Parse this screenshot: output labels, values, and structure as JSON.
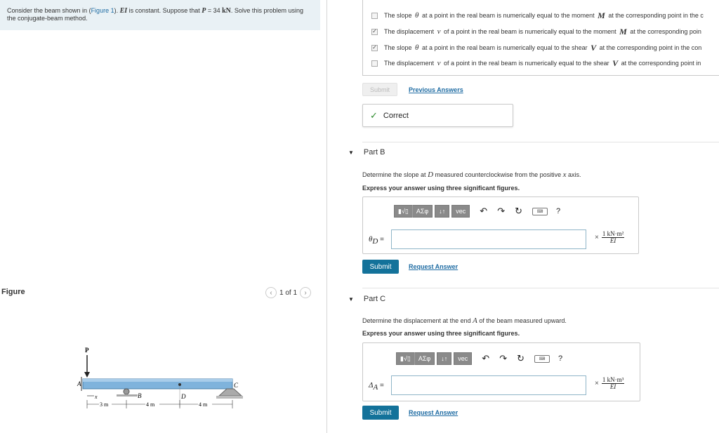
{
  "problem": {
    "text_1": "Consider the beam shown in (",
    "figure_link": "Figure 1",
    "text_2": "). ",
    "ei": "EI",
    "text_3": " is constant. Suppose that ",
    "p_sym": "P",
    "text_4": " = 34 ",
    "unit": "kN",
    "text_5": ". Solve this problem using the conjugate-beam method."
  },
  "figure": {
    "label": "Figure",
    "pager": "1 of 1",
    "labels": {
      "P": "P",
      "A": "A",
      "B": "B",
      "C": "C",
      "D": "D",
      "x": "x",
      "d1": "3 m",
      "d2": "4 m",
      "d3": "4 m"
    }
  },
  "options": [
    {
      "checked": false,
      "pre": "The slope",
      "sym": "θ",
      "mid": "at a point in the real beam is numerically equal to the moment",
      "sym2": "M",
      "post": "at the corresponding point in the c"
    },
    {
      "checked": true,
      "pre": "The displacement",
      "sym": "v",
      "mid": "of a point in the real beam is numerically equal to the moment",
      "sym2": "M",
      "post": "at the corresponding poin"
    },
    {
      "checked": true,
      "pre": "The slope",
      "sym": "θ",
      "mid": "at a point in the real beam is numerically equal to the shear",
      "sym2": "V",
      "post": "at the corresponding point in the con"
    },
    {
      "checked": false,
      "pre": "The displacement",
      "sym": "v",
      "mid": "of a point in the real beam is numerically equal to the shear",
      "sym2": "V",
      "post": "at the corresponding point in"
    }
  ],
  "part_a": {
    "submit": "Submit",
    "previous": "Previous Answers",
    "feedback": "Correct"
  },
  "part_b": {
    "title": "Part B",
    "q1": "Determine the slope at",
    "q_sym": "D",
    "q2": "measured counterclockwise from the positive",
    "q_axis": "x",
    "q3": "axis.",
    "instruction": "Express your answer using three significant figures.",
    "label_sym": "θ",
    "label_sub": "D",
    "label_eq": " =",
    "unit_num": "1 kN·m²",
    "unit_den": "EI",
    "submit": "Submit",
    "request": "Request Answer"
  },
  "part_c": {
    "title": "Part C",
    "q1": "Determine the displacement at the end",
    "q_sym": "A",
    "q2": "of the beam measured upward.",
    "instruction": "Express your answer using three significant figures.",
    "label_sym": "Δ",
    "label_sub": "A",
    "label_eq": " =",
    "unit_num": "1 kN·m³",
    "unit_den": "EI",
    "submit": "Submit",
    "request": "Request Answer"
  },
  "toolbar": {
    "templates": "▮√▯",
    "greek": "ΑΣφ",
    "arrows": "↓↑",
    "vec": "vec",
    "undo_icon": "undo-icon",
    "redo_icon": "redo-icon",
    "reset_icon": "reset-icon",
    "keyboard_icon": "keyboard-icon",
    "help": "?"
  }
}
